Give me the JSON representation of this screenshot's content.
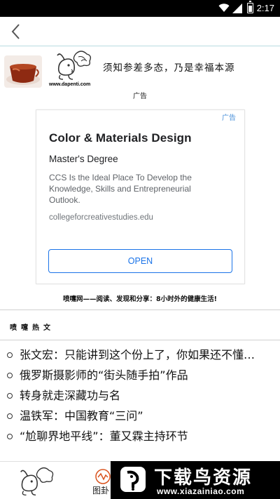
{
  "status_bar": {
    "time": "2:17"
  },
  "header": {
    "site_url": "www.dapenti.com",
    "slogan": "须知参差多态，乃是幸福本源",
    "ad_caption": "广告"
  },
  "ad": {
    "badge": "广告",
    "title": "Color & Materials Design",
    "subtitle": "Master's Degree",
    "description": "CCS Is the Ideal Place To Develop the Knowledge, Skills and Entrepreneurial Outlook.",
    "url": "collegeforcreativestudies.edu",
    "open_label": "OPEN"
  },
  "tagline": "喷嚏网——阅读、发现和分享：8小时外的健康生活!",
  "section": {
    "title": "喷嚏热文",
    "articles": [
      {
        "title": "张文宏：只能讲到这个份上了，你如果还不懂…"
      },
      {
        "title": "俄罗斯摄影师的“街头随手拍”作品"
      },
      {
        "title": "转身就走深藏功与名"
      },
      {
        "title": "温铁军：中国教育“三问”"
      },
      {
        "title": "“尬聊界地平线”：董又霖主持环节"
      }
    ]
  },
  "bottom_nav": {
    "graph_label": "图卦"
  },
  "watermark": {
    "title": "下载鸟资源",
    "url": "www.xiazainiao.com"
  }
}
